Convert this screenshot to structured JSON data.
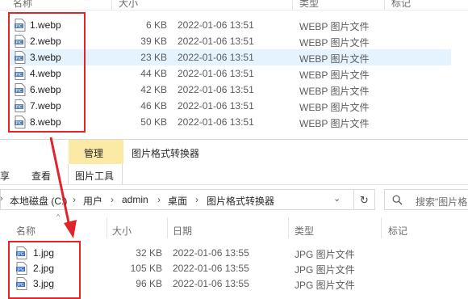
{
  "top_window": {
    "columns": {
      "name": "名称",
      "size": "大小",
      "type": "类型",
      "tags": "标记"
    },
    "files": [
      {
        "name": "1.webp",
        "size": "6 KB",
        "date": "2022-01-06 13:51",
        "type": "WEBP 图片文件"
      },
      {
        "name": "2.webp",
        "size": "39 KB",
        "date": "2022-01-06 13:51",
        "type": "WEBP 图片文件"
      },
      {
        "name": "3.webp",
        "size": "23 KB",
        "date": "2022-01-06 13:51",
        "type": "WEBP 图片文件",
        "selected": true
      },
      {
        "name": "4.webp",
        "size": "44 KB",
        "date": "2022-01-06 13:51",
        "type": "WEBP 图片文件"
      },
      {
        "name": "6.webp",
        "size": "42 KB",
        "date": "2022-01-06 13:51",
        "type": "WEBP 图片文件"
      },
      {
        "name": "7.webp",
        "size": "46 KB",
        "date": "2022-01-06 13:51",
        "type": "WEBP 图片文件"
      },
      {
        "name": "8.webp",
        "size": "50 KB",
        "date": "2022-01-06 13:51",
        "type": "WEBP 图片文件"
      }
    ]
  },
  "bottom_window": {
    "title": "图片格式转换器",
    "ribbon": {
      "context_tab": "管理",
      "tabs": [
        "享",
        "查看",
        "图片工具"
      ]
    },
    "address": {
      "segments": [
        "本地磁盘 (C:)",
        "用户",
        "admin",
        "桌面",
        "图片格式转换器"
      ]
    },
    "search": {
      "placeholder": "搜索\"图片格"
    },
    "columns": {
      "name": "名称",
      "size": "大小",
      "date": "日期",
      "type": "类型",
      "tags": "标记"
    },
    "files": [
      {
        "name": "1.jpg",
        "size": "32 KB",
        "date": "2022-01-06 13:55",
        "type": "JPG 图片文件"
      },
      {
        "name": "2.jpg",
        "size": "105 KB",
        "date": "2022-01-06 13:55",
        "type": "JPG 图片文件"
      },
      {
        "name": "3.jpg",
        "size": "96 KB",
        "date": "2022-01-06 13:55",
        "type": "JPG 图片文件"
      }
    ]
  },
  "colors": {
    "accent_red": "#e0242b",
    "selection": "#e5f3ff",
    "ribbon_context": "#fbe9a6"
  }
}
